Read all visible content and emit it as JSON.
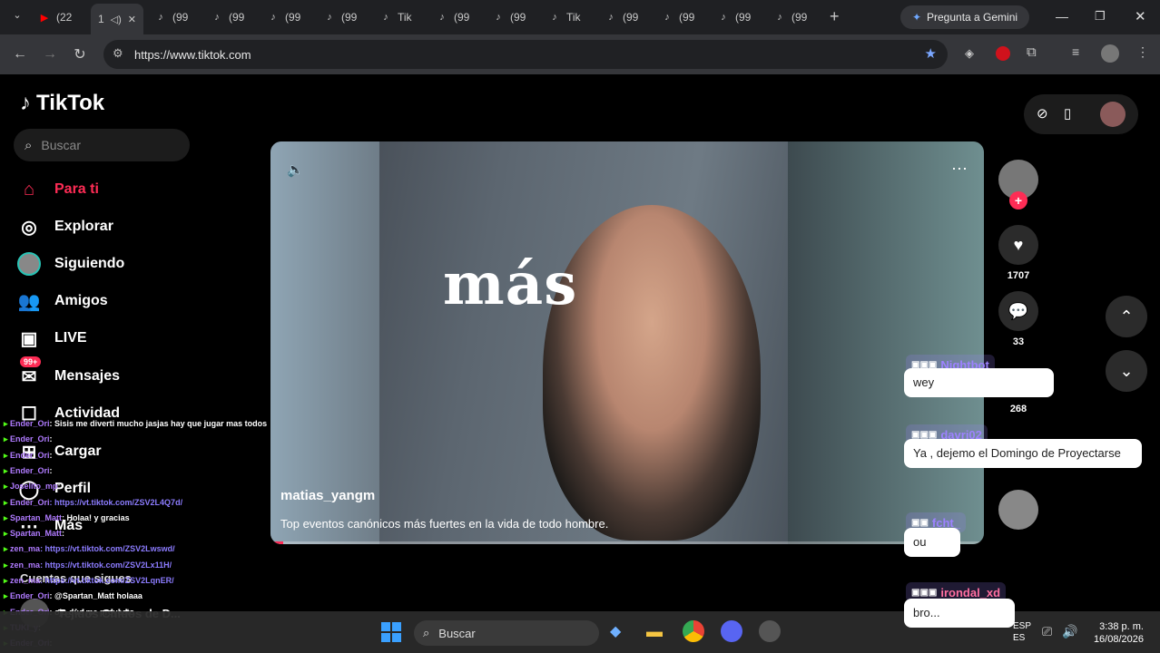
{
  "browser": {
    "tabs": [
      {
        "label": "(22",
        "icon": "youtube-icon"
      },
      {
        "label": "1",
        "icon": "speaker-icon"
      },
      {
        "label": "(99",
        "icon": "tiktok-icon"
      },
      {
        "label": "(99",
        "icon": "tiktok-icon"
      },
      {
        "label": "(99",
        "icon": "tiktok-icon"
      },
      {
        "label": "(99",
        "icon": "tiktok-icon"
      },
      {
        "label": "Tik",
        "icon": "tiktok-icon"
      },
      {
        "label": "(99",
        "icon": "tiktok-icon"
      },
      {
        "label": "(99",
        "icon": "tiktok-icon"
      },
      {
        "label": "Tik",
        "icon": "tiktok-icon"
      },
      {
        "label": "(99",
        "icon": "tiktok-icon"
      },
      {
        "label": "(99",
        "icon": "tiktok-icon"
      },
      {
        "label": "(99",
        "icon": "tiktok-icon"
      },
      {
        "label": "(99",
        "icon": "tiktok-icon"
      }
    ],
    "gemini_label": "Pregunta a Gemini",
    "url": "https://www.tiktok.com"
  },
  "tiktok": {
    "logo": "TikTok",
    "search_placeholder": "Buscar",
    "nav": {
      "for_you": "Para ti",
      "explore": "Explorar",
      "following": "Siguiendo",
      "friends": "Amigos",
      "live": "LIVE",
      "messages": "Mensajes",
      "messages_badge": "99+",
      "activity": "Actividad",
      "upload": "Cargar",
      "profile": "Perfil",
      "more": "Más",
      "following_accounts": "Cuentas que sigues",
      "account_1": "Tejidos Chidos de D..."
    },
    "video": {
      "overlay_text": "más",
      "author": "matias_yangm",
      "caption": "Top eventos canónicos más fuertes en la vida de todo hombre.",
      "progress": 0.018
    },
    "actions": {
      "likes": "1707",
      "comments": "33",
      "saves": "268"
    }
  },
  "chat": [
    {
      "user": "Ender_Ori",
      "text": ": Sisis me diverti mucho jasjas hay que jugar mas todos"
    },
    {
      "user": "Ender_Ori",
      "text": ":"
    },
    {
      "user": "Ender_Ori",
      "text": ":"
    },
    {
      "user": "Ender_Ori",
      "text": ":"
    },
    {
      "user": "Joselito_mp",
      "text": ":"
    },
    {
      "user": "Ender_Ori",
      "text": ": https://vt.tiktok.com/ZSV2L4Q7d/"
    },
    {
      "user": "Spartan_Matt",
      "text": ": Holaa! y gracias"
    },
    {
      "user": "Spartan_Matt",
      "text": ":"
    },
    {
      "user": "zen_ma",
      "text": ": https://vt.tiktok.com/ZSV2Lwswd/"
    },
    {
      "user": "zen_ma",
      "text": ": https://vt.tiktok.com/ZSV2Lx11H/"
    },
    {
      "user": "zen_ma",
      "text": ": https://vt.tiktok.com/ZSV2LqnER/"
    },
    {
      "user": "Ender_Ori",
      "text": ": @Spartan_Matt holaaa"
    },
    {
      "user": "Ender_Ori",
      "text": ": ojo que me proyecto"
    },
    {
      "user": "TUKI_y",
      "text": ":"
    },
    {
      "user": "Ender_Ori",
      "text": ":"
    }
  ],
  "bubbles": [
    {
      "name": "Nightbot",
      "message": "wey"
    },
    {
      "name": "davri02",
      "message": "Ya , dejemo el Domingo de Proyectarse"
    },
    {
      "name": "fcht_",
      "message": "ou"
    },
    {
      "name": "irondal_xd",
      "message": "bro..."
    }
  ],
  "taskbar": {
    "search_placeholder": "Buscar",
    "lang_1": "ESP",
    "lang_2": "ES",
    "time": "3:38 p. m.",
    "date": "16/08/2026"
  },
  "colors": {
    "accent": "#fe2c55",
    "chat_user": "#b07bff",
    "chat_link": "#8c7cff"
  }
}
